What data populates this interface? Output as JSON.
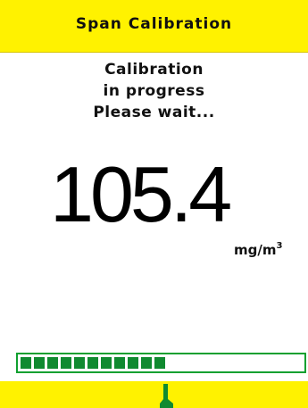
{
  "header": {
    "title": "Span Calibration"
  },
  "status": {
    "line1": "Calibration",
    "line2": "in progress",
    "line3": "Please wait..."
  },
  "reading": {
    "value": "105.4",
    "unit_base": "mg/m",
    "unit_exponent": "3"
  },
  "progress": {
    "fraction": 0.52
  },
  "colors": {
    "title_bar": "#fff200",
    "progress": "#108a30"
  },
  "icons": {
    "pointer": "pointer-marker-icon"
  }
}
